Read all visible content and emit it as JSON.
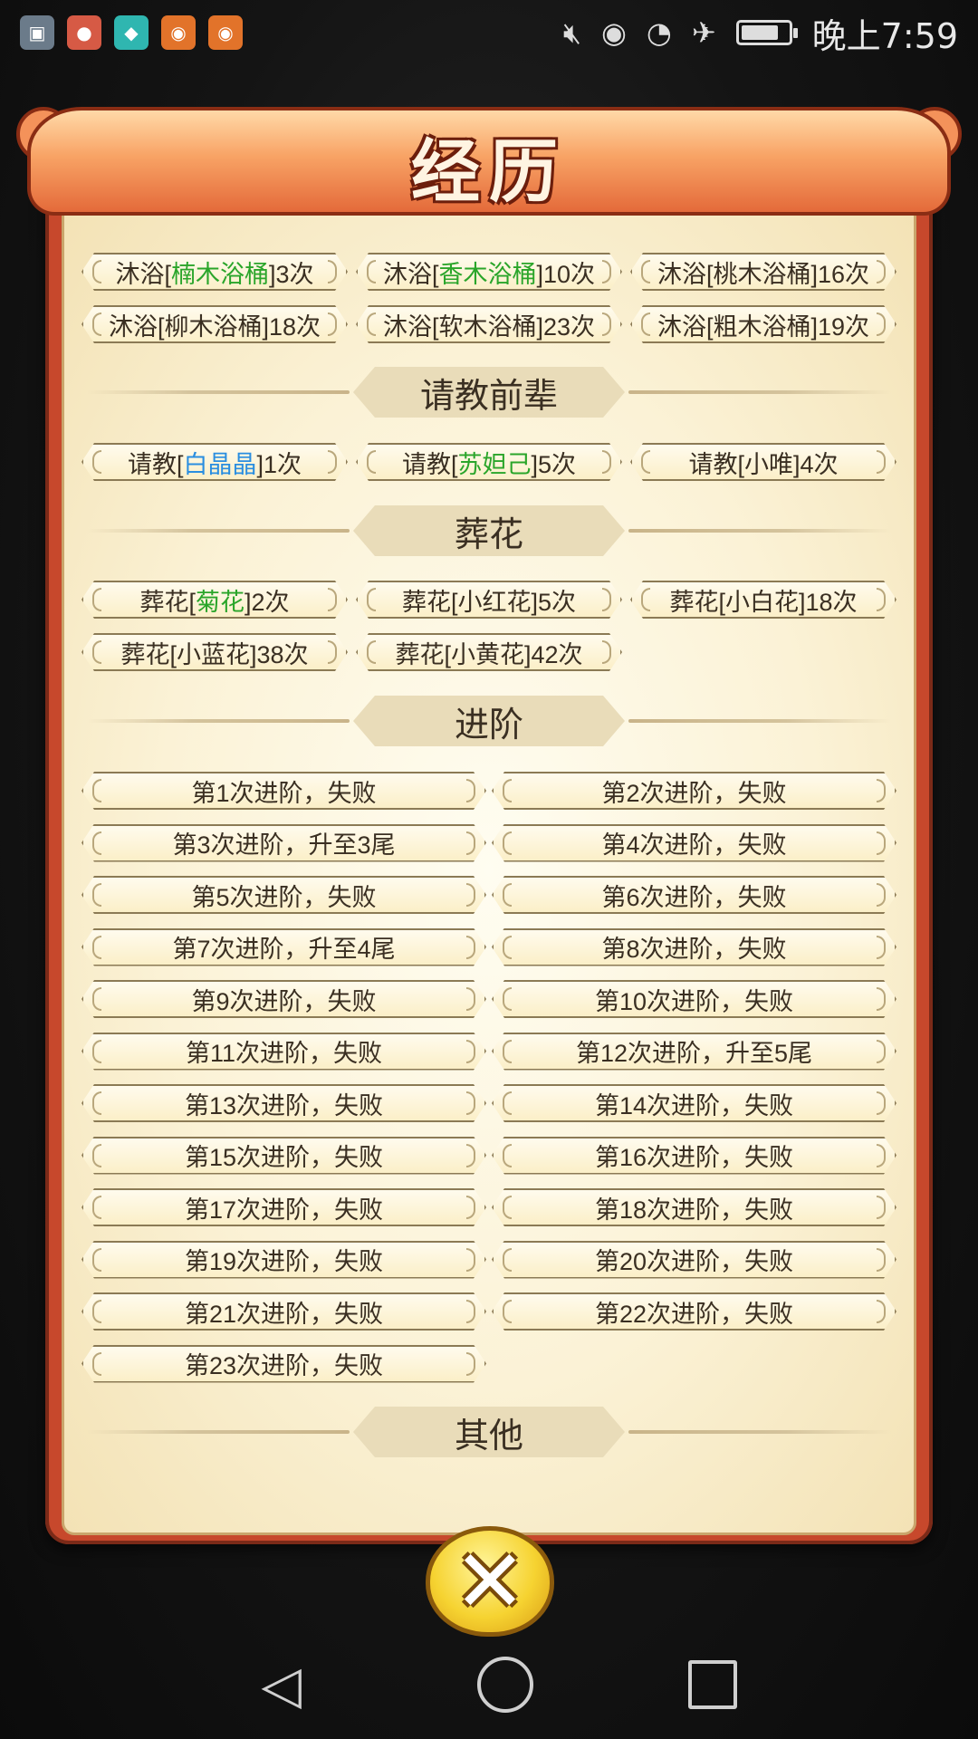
{
  "status_bar": {
    "time": "晚上7:59",
    "left_icons": [
      {
        "name": "gallery-app-icon",
        "color": "#6b7b8a",
        "glyph": "▣"
      },
      {
        "name": "screen-record-app-icon",
        "color": "#d65a45",
        "glyph": "●"
      },
      {
        "name": "shield-app-icon",
        "color": "#2fb6b0",
        "glyph": "◆"
      },
      {
        "name": "game-app-icon-1",
        "color": "#e2732a",
        "glyph": "◉"
      },
      {
        "name": "game-app-icon-2",
        "color": "#e2732a",
        "glyph": "◉"
      }
    ],
    "right_icons": [
      "mute-icon",
      "eye-care-icon",
      "wifi-icon",
      "airplane-mode-icon",
      "battery-icon"
    ]
  },
  "dialog": {
    "title": "经历",
    "bath": {
      "items": [
        {
          "prefix": "沐浴[",
          "name": "楠木浴桶",
          "suffix": "]3次",
          "name_color": "green"
        },
        {
          "prefix": "沐浴[",
          "name": "香木浴桶",
          "suffix": "]10次",
          "name_color": "green"
        },
        {
          "prefix": "沐浴[",
          "name": "桃木浴桶",
          "suffix": "]16次",
          "name_color": "plain"
        },
        {
          "prefix": "沐浴[",
          "name": "柳木浴桶",
          "suffix": "]18次",
          "name_color": "plain"
        },
        {
          "prefix": "沐浴[",
          "name": "软木浴桶",
          "suffix": "]23次",
          "name_color": "plain"
        },
        {
          "prefix": "沐浴[",
          "name": "粗木浴桶",
          "suffix": "]19次",
          "name_color": "plain"
        }
      ]
    },
    "consult": {
      "header": "请教前辈",
      "items": [
        {
          "prefix": "请教[",
          "name": "白晶晶",
          "suffix": "]1次",
          "name_color": "blue"
        },
        {
          "prefix": "请教[",
          "name": "苏妲己",
          "suffix": "]5次",
          "name_color": "green"
        },
        {
          "prefix": "请教[",
          "name": "小唯",
          "suffix": "]4次",
          "name_color": "plain"
        }
      ]
    },
    "flowers": {
      "header": "葬花",
      "items": [
        {
          "prefix": "葬花[",
          "name": "菊花",
          "suffix": "]2次",
          "name_color": "green"
        },
        {
          "prefix": "葬花[",
          "name": "小红花",
          "suffix": "]5次",
          "name_color": "plain"
        },
        {
          "prefix": "葬花[",
          "name": "小白花",
          "suffix": "]18次",
          "name_color": "plain"
        },
        {
          "prefix": "葬花[",
          "name": "小蓝花",
          "suffix": "]38次",
          "name_color": "plain"
        },
        {
          "prefix": "葬花[",
          "name": "小黄花",
          "suffix": "]42次",
          "name_color": "plain"
        }
      ]
    },
    "advance": {
      "header": "进阶",
      "items": [
        "第1次进阶，失败",
        "第2次进阶，失败",
        "第3次进阶，升至3尾",
        "第4次进阶，失败",
        "第5次进阶，失败",
        "第6次进阶，失败",
        "第7次进阶，升至4尾",
        "第8次进阶，失败",
        "第9次进阶，失败",
        "第10次进阶，失败",
        "第11次进阶，失败",
        "第12次进阶，升至5尾",
        "第13次进阶，失败",
        "第14次进阶，失败",
        "第15次进阶，失败",
        "第16次进阶，失败",
        "第17次进阶，失败",
        "第18次进阶，失败",
        "第19次进阶，失败",
        "第20次进阶，失败",
        "第21次进阶，失败",
        "第22次进阶，失败",
        "第23次进阶，失败"
      ]
    },
    "other": {
      "header": "其他"
    },
    "close_glyph": "✕"
  },
  "nav_bar": {
    "back_glyph": "◁"
  }
}
